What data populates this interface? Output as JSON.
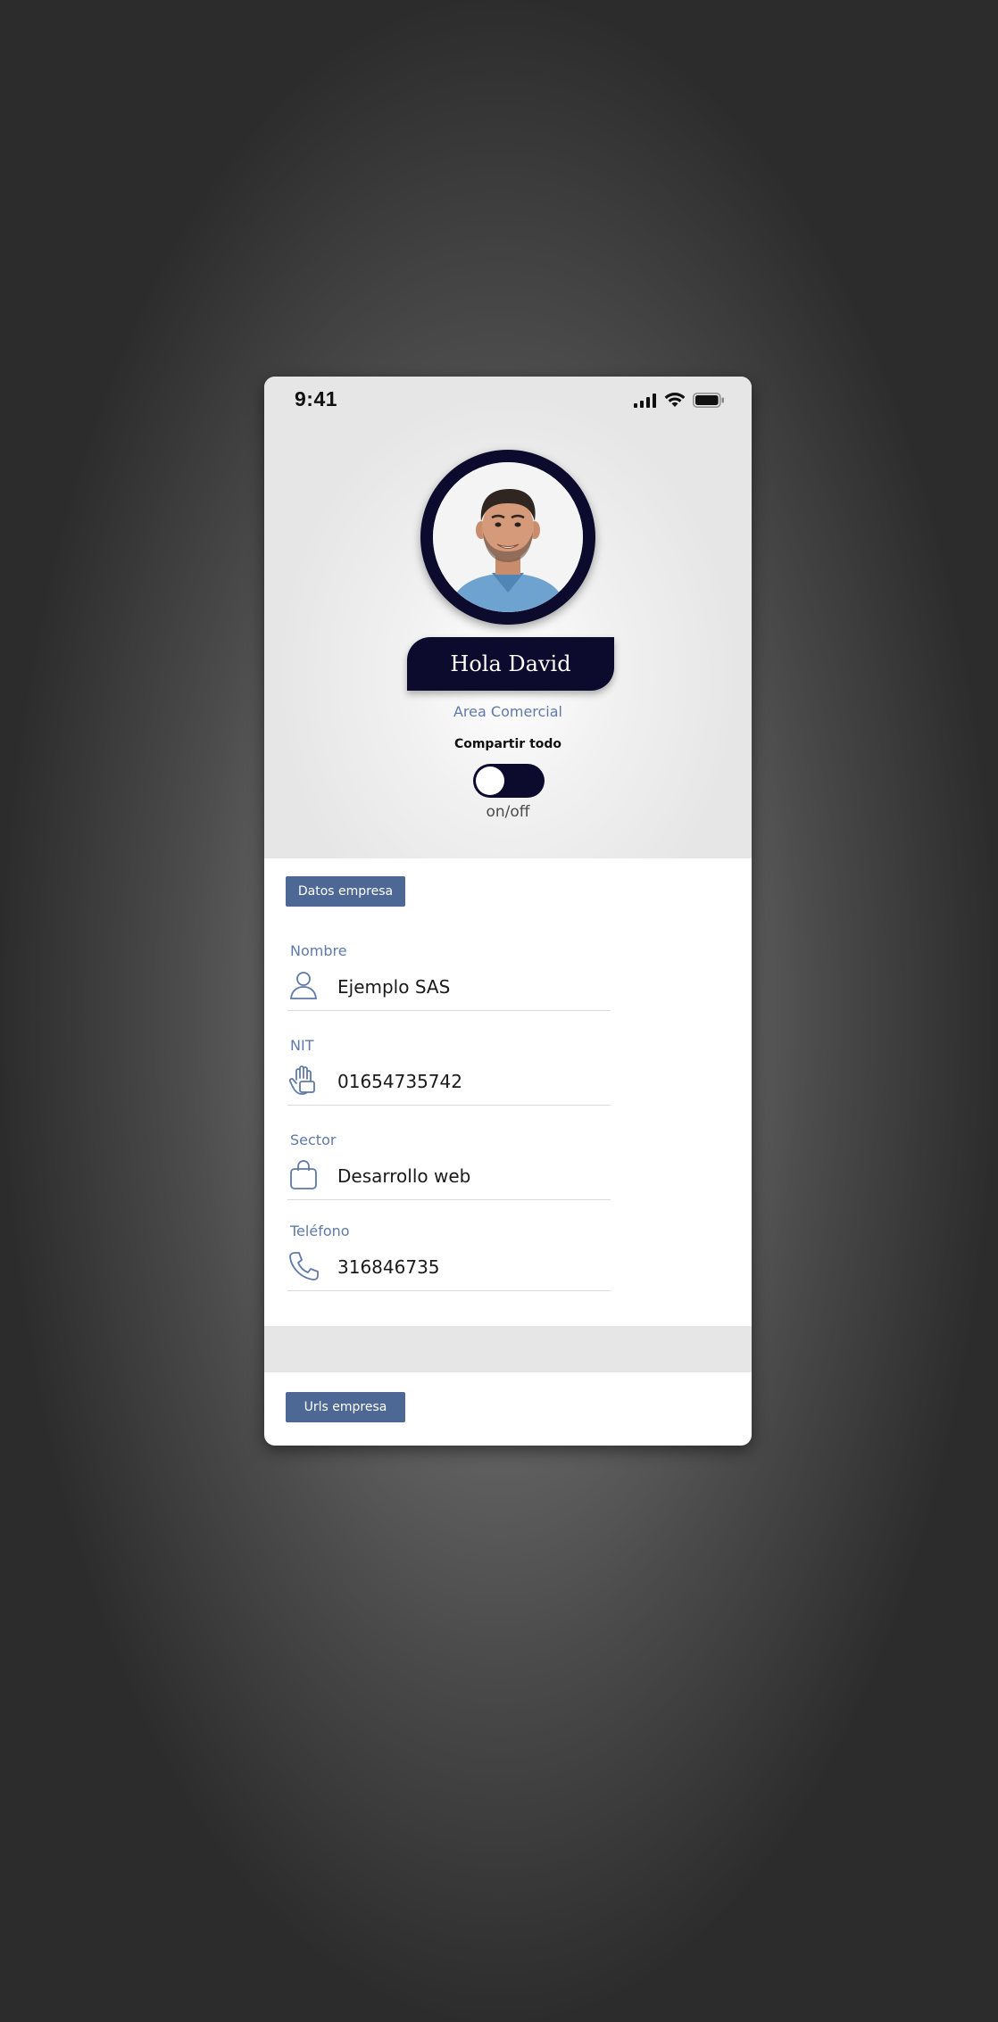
{
  "status_bar": {
    "time": "9:41",
    "icons": [
      "signal-icon",
      "wifi-icon",
      "battery-icon"
    ]
  },
  "profile": {
    "greeting": "Hola David",
    "area": "Area Comercial",
    "share_label": "Compartir todo",
    "toggle_caption": "on/off",
    "toggle_on": true
  },
  "company": {
    "section_title": "Datos empresa",
    "fields": [
      {
        "label": "Nombre",
        "value": "Ejemplo SAS",
        "icon": "user-icon"
      },
      {
        "label": "NIT",
        "value": "01654735742",
        "icon": "hand-icon"
      },
      {
        "label": "Sector",
        "value": "Desarrollo web",
        "icon": "shopping-bag-icon"
      },
      {
        "label": "Teléfono",
        "value": "316846735",
        "icon": "phone-icon"
      }
    ]
  },
  "urls": {
    "section_title": "Urls empresa"
  },
  "colors": {
    "navy": "#0c0b2e",
    "accent_blue": "#4e6895",
    "label_blue": "#5f7aa8"
  }
}
